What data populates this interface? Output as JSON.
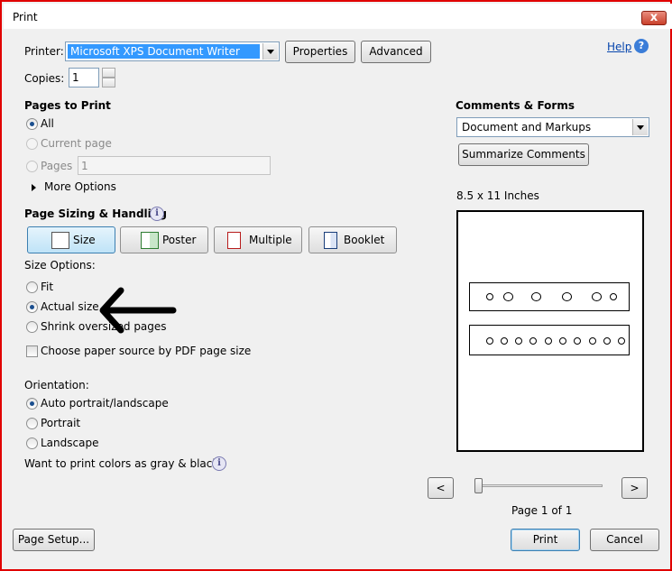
{
  "window": {
    "title": "Print",
    "close_glyph": "x"
  },
  "printer": {
    "label": "Printer:",
    "value": "Microsoft XPS Document Writer",
    "properties": "Properties",
    "advanced": "Advanced"
  },
  "help": {
    "label": "Help"
  },
  "copies": {
    "label": "Copies:",
    "value": "1"
  },
  "pages": {
    "heading": "Pages to Print",
    "all": "All",
    "current": "Current page",
    "pages": "Pages",
    "range_value": "1",
    "more": "More Options"
  },
  "sizing": {
    "heading": "Page Sizing & Handling",
    "modes": [
      "Size",
      "Poster",
      "Multiple",
      "Booklet"
    ],
    "options_label": "Size Options:",
    "fit": "Fit",
    "actual": "Actual size",
    "shrink": "Shrink oversized pages",
    "choose_source": "Choose paper source by PDF page size"
  },
  "orientation": {
    "label": "Orientation:",
    "auto": "Auto portrait/landscape",
    "portrait": "Portrait",
    "landscape": "Landscape"
  },
  "gray_question": "Want to print colors as gray & black?",
  "comments": {
    "heading": "Comments & Forms",
    "value": "Document and Markups",
    "summarize": "Summarize Comments"
  },
  "preview": {
    "size_label": "8.5 x 11 Inches",
    "page_text": "Page 1 of 1",
    "prev": "<",
    "next": ">"
  },
  "footer": {
    "page_setup": "Page Setup...",
    "print": "Print",
    "cancel": "Cancel"
  },
  "colors": {
    "selection_blue": "#3399ff",
    "frame_red": "#e00000",
    "link_blue": "#0645ad"
  }
}
